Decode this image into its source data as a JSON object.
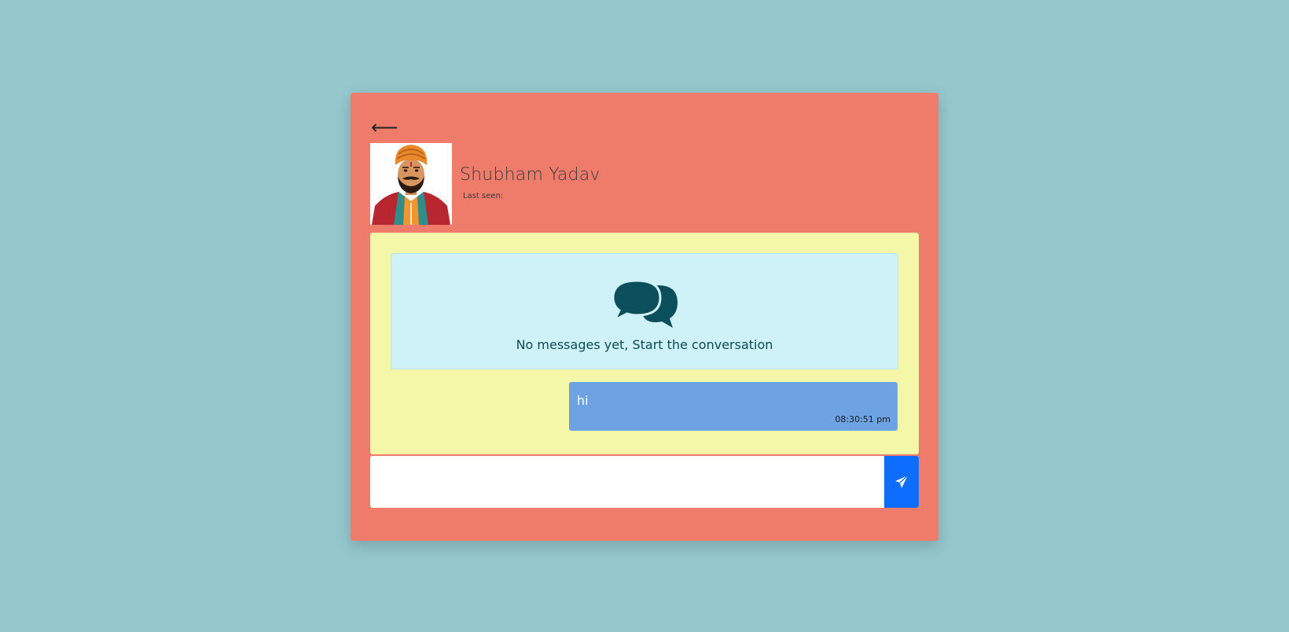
{
  "header": {
    "back_icon": "arrow-left-icon",
    "back_glyph": "⟵",
    "contact_name": "Shubham Yadav",
    "last_seen": "Last seen:"
  },
  "chat": {
    "empty_state": {
      "icon": "chat-bubbles-icon",
      "text": "No messages yet, Start the conversation"
    },
    "messages": [
      {
        "text": "hi",
        "time": "08:30:51 pm",
        "direction": "outgoing"
      }
    ]
  },
  "composer": {
    "input_value": "",
    "send_icon": "paper-plane-icon"
  },
  "colors": {
    "page_background": "#95c7cd",
    "card_background": "#ef7c6a",
    "chat_background": "#f4f7a8",
    "empty_state_background": "#cff2f9",
    "empty_state_text": "#0c4a55",
    "outgoing_bubble": "#6ea3e3",
    "send_button": "#0d6efd"
  }
}
